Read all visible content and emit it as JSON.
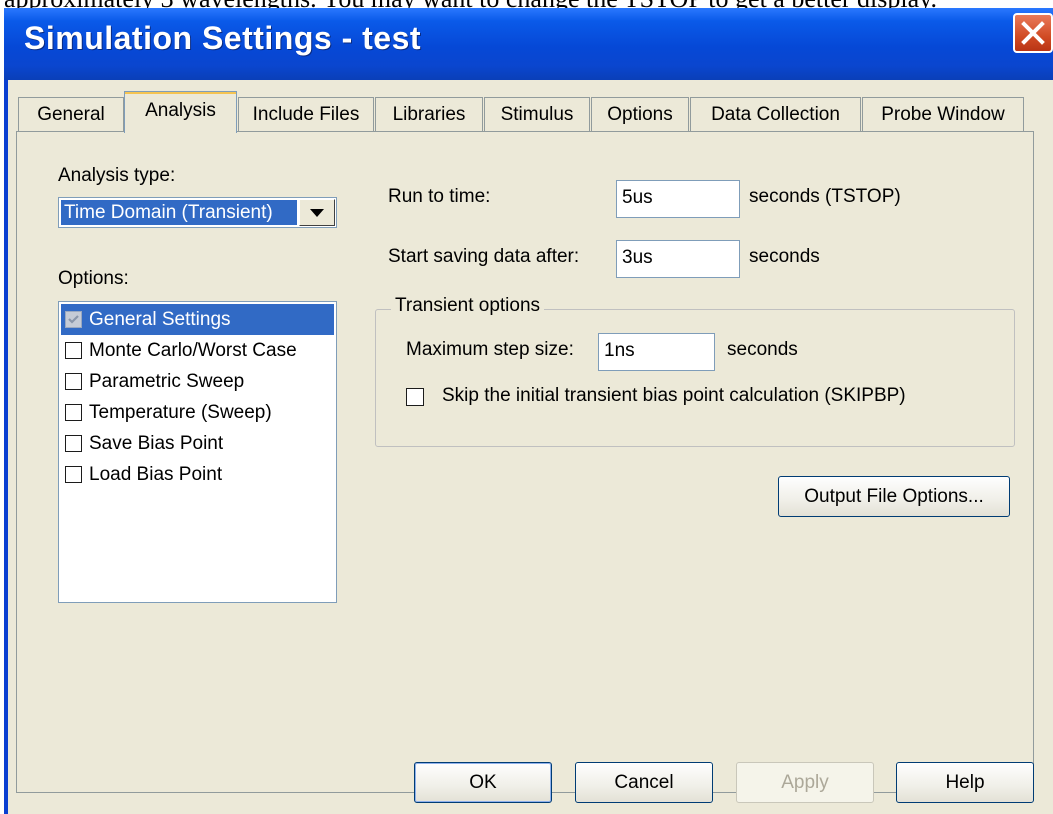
{
  "document": {
    "cut_text": "approximately 3 wavelengths. You may want to change the TSTOP to get a better display."
  },
  "window": {
    "title": "Simulation Settings - test"
  },
  "tabs": [
    {
      "label": "General",
      "active": false
    },
    {
      "label": "Analysis",
      "active": true
    },
    {
      "label": "Include Files",
      "active": false
    },
    {
      "label": "Libraries",
      "active": false
    },
    {
      "label": "Stimulus",
      "active": false
    },
    {
      "label": "Options",
      "active": false
    },
    {
      "label": "Data Collection",
      "active": false
    },
    {
      "label": "Probe Window",
      "active": false
    }
  ],
  "analysis": {
    "type_label": "Analysis type:",
    "type_value": "Time Domain (Transient)",
    "options_label": "Options:",
    "options": [
      {
        "label": "General Settings",
        "checked": true,
        "selected": true
      },
      {
        "label": "Monte Carlo/Worst Case",
        "checked": false,
        "selected": false
      },
      {
        "label": "Parametric Sweep",
        "checked": false,
        "selected": false
      },
      {
        "label": "Temperature (Sweep)",
        "checked": false,
        "selected": false
      },
      {
        "label": "Save Bias Point",
        "checked": false,
        "selected": false
      },
      {
        "label": "Load Bias Point",
        "checked": false,
        "selected": false
      }
    ]
  },
  "run": {
    "run_to_label": "Run to time:",
    "run_to_value": "5us",
    "run_to_unit": "seconds  (TSTOP)",
    "start_label": "Start saving data after:",
    "start_value": "3us",
    "start_unit": "seconds"
  },
  "transient": {
    "group_label": "Transient options",
    "max_step_label": "Maximum step size:",
    "max_step_value": "1ns",
    "max_step_unit": "seconds",
    "skip_label": "Skip the initial transient bias point calculation  (SKIPBP)",
    "skip_checked": false
  },
  "buttons": {
    "output_file_options": "Output File Options...",
    "ok": "OK",
    "cancel": "Cancel",
    "apply": "Apply",
    "help": "Help"
  },
  "colors": {
    "titlebar": "#0a5ae9",
    "selection": "#316ac5",
    "dialog_bg": "#ece9d8",
    "close_button": "#d14b24"
  }
}
